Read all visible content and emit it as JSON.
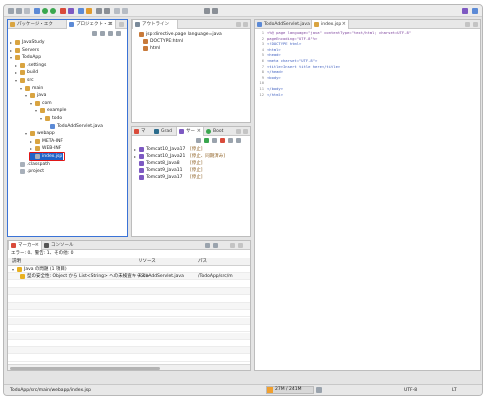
{
  "explorer": {
    "tabs": [
      "パッケージ・エク",
      "プロジェクト・エ"
    ],
    "tree": [
      {
        "label": "JavaStudy",
        "expanded": false,
        "indent": 0
      },
      {
        "label": "Servers",
        "expanded": false,
        "indent": 0
      },
      {
        "label": "TodoApp",
        "expanded": true,
        "indent": 0
      },
      {
        "label": ".settings",
        "expanded": false,
        "indent": 1
      },
      {
        "label": "build",
        "expanded": false,
        "indent": 1
      },
      {
        "label": "src",
        "expanded": true,
        "indent": 1
      },
      {
        "label": "main",
        "expanded": true,
        "indent": 2
      },
      {
        "label": "java",
        "expanded": true,
        "indent": 3
      },
      {
        "label": "com",
        "expanded": true,
        "indent": 4
      },
      {
        "label": "example",
        "expanded": true,
        "indent": 5
      },
      {
        "label": "todo",
        "expanded": true,
        "indent": 6
      },
      {
        "label": "TodoAddServlet.java",
        "expanded": null,
        "indent": 7
      },
      {
        "label": "webapp",
        "expanded": true,
        "indent": 3
      },
      {
        "label": "META-INF",
        "expanded": false,
        "indent": 4
      },
      {
        "label": "WEB-INF",
        "expanded": false,
        "indent": 4
      },
      {
        "label": "index.jsp",
        "expanded": null,
        "indent": 4,
        "selected": true
      },
      {
        "label": ".classpath",
        "expanded": null,
        "indent": 1
      },
      {
        "label": ".project",
        "expanded": null,
        "indent": 1
      }
    ]
  },
  "outline": {
    "tab": "アウトライン",
    "items": [
      "jsp:directive.page language=java",
      "DOCTYPE:html",
      "html"
    ]
  },
  "servers": {
    "tabs": [
      "マ",
      "Grad",
      "サー",
      "Boot"
    ],
    "items": [
      {
        "name": "Tomcat10_Java17",
        "state": "[停止]",
        "expandable": true
      },
      {
        "name": "Tomcat10_Java21",
        "state": "[停止、同期済み]",
        "expandable": true
      },
      {
        "name": "Tomcat8_Java8",
        "state": "[停止]",
        "expandable": false
      },
      {
        "name": "Tomcat9_Java11",
        "state": "[停止]",
        "expandable": false
      },
      {
        "name": "Tomcat9_Java17",
        "state": "[停止]",
        "expandable": false
      }
    ]
  },
  "editor": {
    "tabs": [
      "TodoAddServlet.java",
      "index.jsp"
    ],
    "lines": [
      "<%@ page language=\"java\" contentType=\"text/html; charset=UTF-8\"",
      "    pageEncoding=\"UTF-8\"%>",
      "<!DOCTYPE html>",
      "<html>",
      "<head>",
      "<meta charset=\"UTF-8\">",
      "<title>Insert title here</title>",
      "</head>",
      "<body>",
      "",
      "</body>",
      "</html>"
    ]
  },
  "problems": {
    "tabs": [
      "マーカー",
      "コンソール"
    ],
    "summary": "エラー: 0、警告: 1、その他: 0",
    "columns": [
      "説明",
      "リソース",
      "パス"
    ],
    "group": "Java の問題 (1 項目)",
    "rows": [
      {
        "desc": "型の安全性: Object から List<String> への未検査キャスト",
        "resource": "TodoAddServlet.java",
        "path": "/TodoApp/src/m"
      }
    ]
  },
  "status": {
    "path": "TodoApp/src/main/webapp/index.jsp",
    "memory": "27M / 241M",
    "encoding": "UTF-8",
    "lt": "LT"
  },
  "colors": {
    "selection": "#1f63c8",
    "highlight": "#e01818",
    "folder": "#d9a441",
    "memory_bar": "#f0a030"
  }
}
